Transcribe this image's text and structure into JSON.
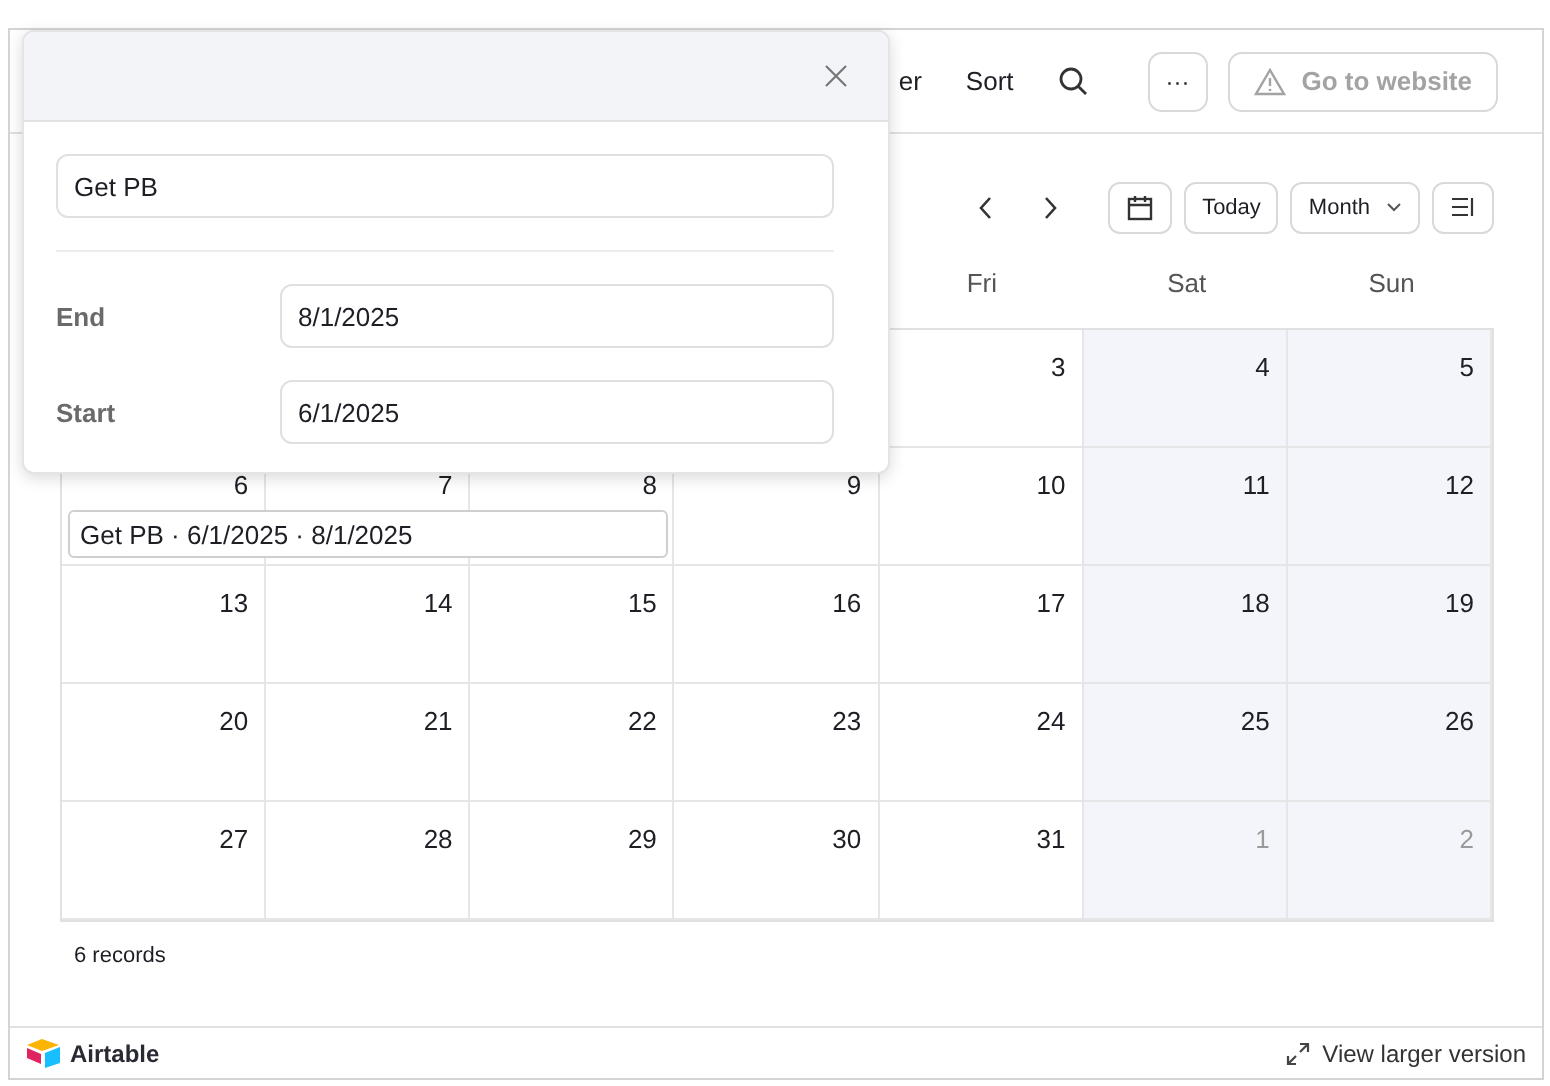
{
  "toolbar": {
    "partial_label": "er",
    "sort": "Sort",
    "more": "···",
    "website": {
      "label": "Go to website",
      "disabled": true
    }
  },
  "nav": {
    "today": "Today",
    "view": "Month"
  },
  "weekdays": [
    "Fri",
    "Sat",
    "Sun"
  ],
  "weeks": [
    [
      {
        "label": "3",
        "muted": false
      },
      {
        "label": "4",
        "muted": false
      },
      {
        "label": "5",
        "muted": false
      }
    ],
    [
      {
        "label": "6",
        "muted": false
      },
      {
        "label": "7",
        "muted": false
      },
      {
        "label": "8",
        "muted": false
      },
      {
        "label": "9",
        "muted": false
      },
      {
        "label": "10",
        "muted": false
      },
      {
        "label": "11",
        "muted": false
      },
      {
        "label": "12",
        "muted": false
      }
    ],
    [
      {
        "label": "13",
        "muted": false
      },
      {
        "label": "14",
        "muted": false
      },
      {
        "label": "15",
        "muted": false
      },
      {
        "label": "16",
        "muted": false
      },
      {
        "label": "17",
        "muted": false
      },
      {
        "label": "18",
        "muted": false
      },
      {
        "label": "19",
        "muted": false
      }
    ],
    [
      {
        "label": "20",
        "muted": false
      },
      {
        "label": "21",
        "muted": false
      },
      {
        "label": "22",
        "muted": false
      },
      {
        "label": "23",
        "muted": false
      },
      {
        "label": "24",
        "muted": false
      },
      {
        "label": "25",
        "muted": false
      },
      {
        "label": "26",
        "muted": false
      }
    ],
    [
      {
        "label": "27",
        "muted": false
      },
      {
        "label": "28",
        "muted": false
      },
      {
        "label": "29",
        "muted": false
      },
      {
        "label": "30",
        "muted": false
      },
      {
        "label": "31",
        "muted": false
      },
      {
        "label": "1",
        "muted": true
      },
      {
        "label": "2",
        "muted": true
      }
    ]
  ],
  "event": {
    "label": "Get PB · 6/1/2025 · 8/1/2025"
  },
  "popup": {
    "title_value": "Get PB",
    "fields": [
      {
        "label": "End",
        "value": "8/1/2025"
      },
      {
        "label": "Start",
        "value": "6/1/2025"
      }
    ]
  },
  "records": "6 records",
  "footer": {
    "brand": "Airtable",
    "link": "View larger version"
  }
}
